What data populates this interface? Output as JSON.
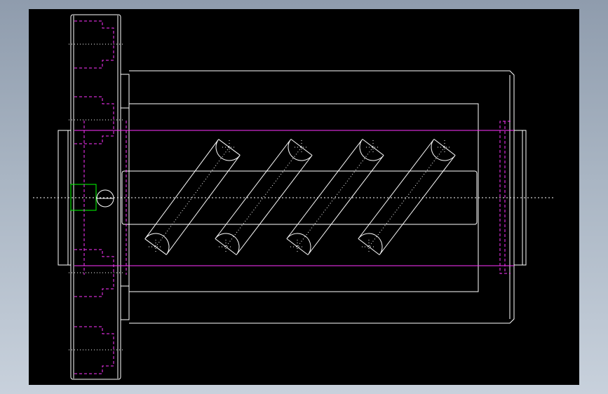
{
  "app": {
    "view": "cad-drawing-viewport"
  },
  "colors": {
    "page_bg": "#9aa6b5",
    "viewport_bg": "#000000",
    "outline": "#ffffff",
    "hidden_line": "#ff33ff",
    "highlight": "#00ff00"
  },
  "drawing": {
    "subject": "ball-screw-nut-side-view",
    "helix_turn_count": 4,
    "flange_bolt_hole_count": 6
  }
}
